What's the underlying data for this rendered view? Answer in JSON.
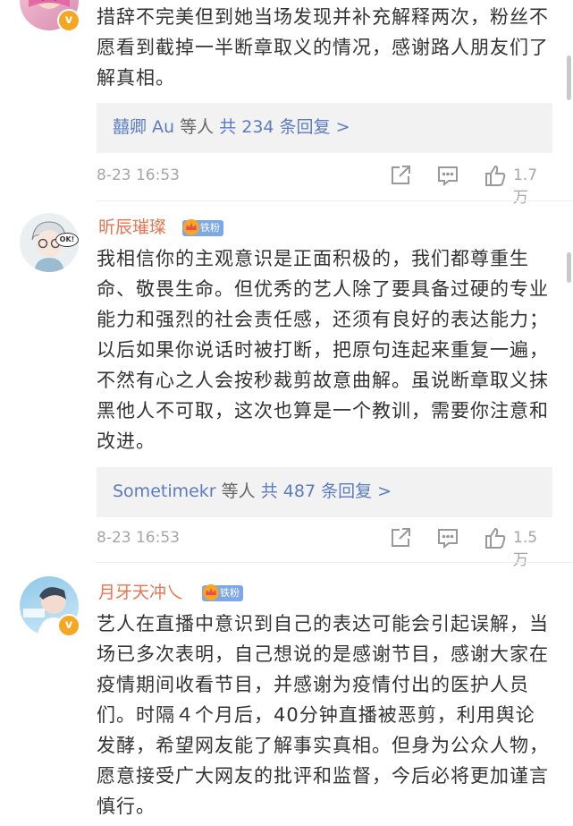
{
  "comments": [
    {
      "username": "",
      "text": "措辞不完美但到她当场发现并补充解释两次，粉丝不愿看到截掉一半断章取义的情况，感谢路人朋友们了解真相。",
      "reply_user": "囍卿 Au",
      "reply_mid": "等人",
      "reply_count": "共 234 条回复 >",
      "time": "8-23 16:53",
      "likes": "1.7万"
    },
    {
      "username": "昕辰璀璨",
      "badge": "铁粉",
      "text": "我相信你的主观意识是正面积极的，我们都尊重生命、敬畏生命。但优秀的艺人除了要具备过硬的专业能力和强烈的社会责任感，还须有良好的表达能力；以后如果你说话时被打断，把原句连起来重复一遍，不然有心之人会按秒裁剪故意曲解。虽说断章取义抹黑他人不可取，这次也算是一个教训，需要你注意和改进。",
      "reply_user": "Sometimekr",
      "reply_mid": "等人",
      "reply_count": "共 487 条回复 >",
      "time": "8-23 16:53",
      "likes": "1.5万"
    },
    {
      "username": "月牙天冲乀",
      "badge": "铁粉",
      "text": "艺人在直播中意识到自己的表达可能会引起误解，当场已多次表明，自己想说的是感谢节目，感谢大家在疫情期间收看节目，并感谢为疫情付出的医护人员们。时隔４个月后，40分钟直播被恶剪，利用舆论发酵，希望网友能了解事实真相。但身为公众人物，愿意接受广大网友的批评和监督，今后必将更加谨言慎行。"
    }
  ],
  "avatar_text": "OK!",
  "colors": {
    "username": "#eb7350",
    "link": "#5b7cc0",
    "badge": "#7ea7e6",
    "verified": "#f5a623"
  },
  "icons": [
    "share-icon",
    "comment-icon",
    "like-icon",
    "verified-icon",
    "crown-icon"
  ]
}
